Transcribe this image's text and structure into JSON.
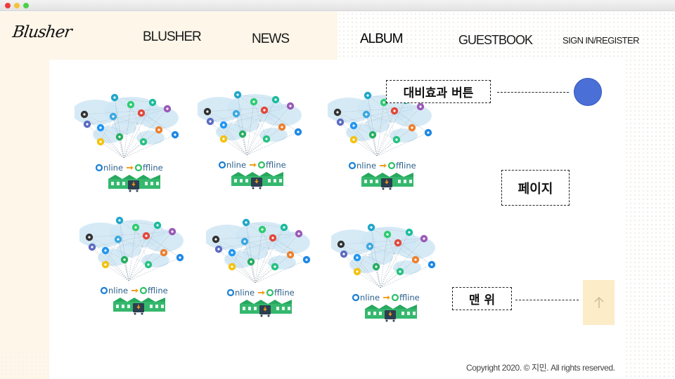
{
  "brand": {
    "logo_text": "Blusher"
  },
  "nav": {
    "items": [
      {
        "label": "BLUSHER"
      },
      {
        "label": "NEWS"
      },
      {
        "label": "ALBUM"
      },
      {
        "label": "GUESTBOOK"
      },
      {
        "label": "SIGN IN/REGISTER"
      }
    ]
  },
  "gallery": {
    "items": [
      {
        "caption_online": "nline",
        "caption_offline": "ffline"
      },
      {
        "caption_online": "nline",
        "caption_offline": "ffline"
      },
      {
        "caption_online": "nline",
        "caption_offline": "ffline"
      },
      {
        "caption_online": "nline",
        "caption_offline": "ffline"
      },
      {
        "caption_online": "nline",
        "caption_offline": "ffline"
      },
      {
        "caption_online": "nline",
        "caption_offline": "ffline"
      }
    ]
  },
  "annotations": {
    "contrast_button_label": "대비효과 버튼",
    "pagination_label": "페이지",
    "back_to_top_label": "맨 위"
  },
  "controls": {
    "contrast_button_color": "#4a6fd6",
    "top_button_icon": "arrow-up-icon",
    "top_button_color": "#fcecc8"
  },
  "footer": {
    "copyright": "Copyright 2020. © 지민. All rights reserved."
  },
  "colors": {
    "header_bg": "#fdf6e9",
    "online_blue": "#1a7fd4",
    "offline_green": "#2fbf6a"
  }
}
